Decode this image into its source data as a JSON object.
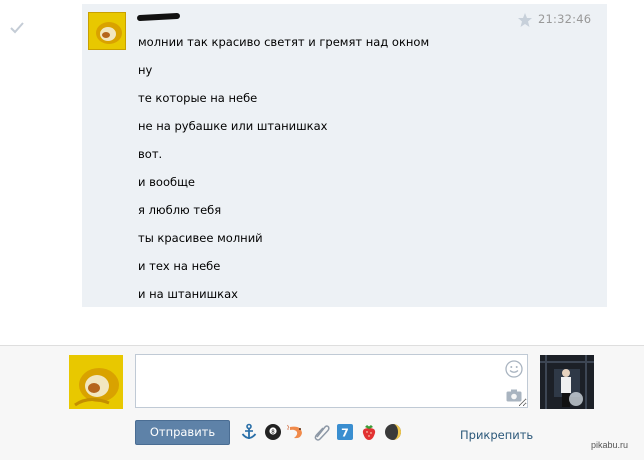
{
  "conversation": {
    "message": {
      "time": "21:32:46",
      "lines": [
        "молнии так красиво светят и гремят над окном",
        "ну",
        "те которые на небе",
        "не на рубашке или штанишках",
        "вот.",
        "и вообще",
        "я люблю тебя",
        "ты красивее молний",
        "и тех на небе",
        "и на штанишках"
      ]
    }
  },
  "composer": {
    "input_value": "",
    "send_label": "Отправить",
    "attach_label": "Прикрепить",
    "emoji_icons": [
      "anchor",
      "billiard-8-ball",
      "shrimp",
      "paperclip",
      "number-7",
      "strawberry",
      "moon"
    ]
  },
  "watermark": "pikabu.ru",
  "colors": {
    "message_bg": "#edf1f5",
    "send_button": "#5e82a8",
    "link": "#2b587a",
    "time": "#999999"
  }
}
